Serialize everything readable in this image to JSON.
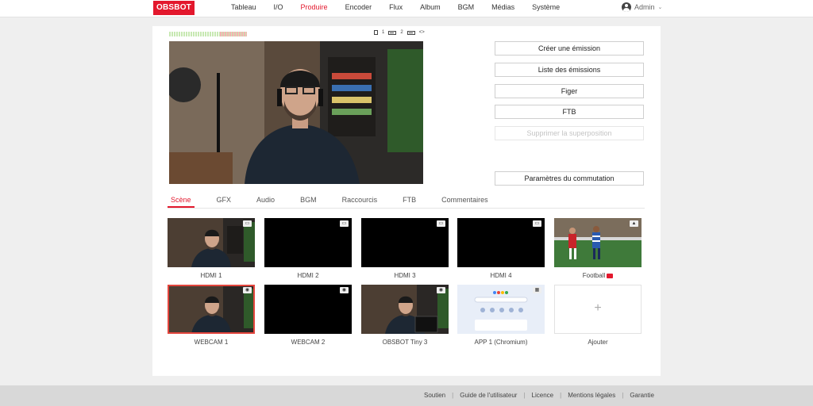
{
  "header": {
    "logo": "OBSBOT",
    "nav": [
      {
        "label": "Tableau",
        "active": false
      },
      {
        "label": "I/O",
        "active": false
      },
      {
        "label": "Produire",
        "active": true
      },
      {
        "label": "Encoder",
        "active": false
      },
      {
        "label": "Flux",
        "active": false
      },
      {
        "label": "Album",
        "active": false
      },
      {
        "label": "BGM",
        "active": false
      },
      {
        "label": "Médias",
        "active": false
      },
      {
        "label": "Système",
        "active": false
      }
    ],
    "user": "Admin"
  },
  "status": {
    "cam1": "1",
    "cam2": "2",
    "swap_icon": "<>"
  },
  "actions": {
    "create_show": "Créer une émission",
    "show_list": "Liste des émissions",
    "freeze": "Figer",
    "ftb": "FTB",
    "remove_overlay": "Supprimer la superposition",
    "switch_settings": "Paramètres du commutation"
  },
  "tabs": [
    "Scène",
    "GFX",
    "Audio",
    "BGM",
    "Raccourcis",
    "FTB",
    "Commentaires"
  ],
  "sources": [
    {
      "label": "HDMI 1",
      "content": "webcam"
    },
    {
      "label": "HDMI 2",
      "content": "black"
    },
    {
      "label": "HDMI 3",
      "content": "black"
    },
    {
      "label": "HDMI 4",
      "content": "black"
    },
    {
      "label": "Football",
      "content": "football"
    },
    {
      "label": "WEBCAM 1",
      "content": "webcam",
      "selected": true
    },
    {
      "label": "WEBCAM 2",
      "content": "black"
    },
    {
      "label": "OBSBOT Tiny 3",
      "content": "webcam"
    },
    {
      "label": "APP 1 (Chromium)",
      "content": "browser"
    },
    {
      "label": "Ajouter",
      "content": "add"
    }
  ],
  "footer": [
    "Soutien",
    "Guide de l'utilisateur",
    "Licence",
    "Mentions légales",
    "Garantie"
  ],
  "colors": {
    "accent": "#e3182d"
  }
}
